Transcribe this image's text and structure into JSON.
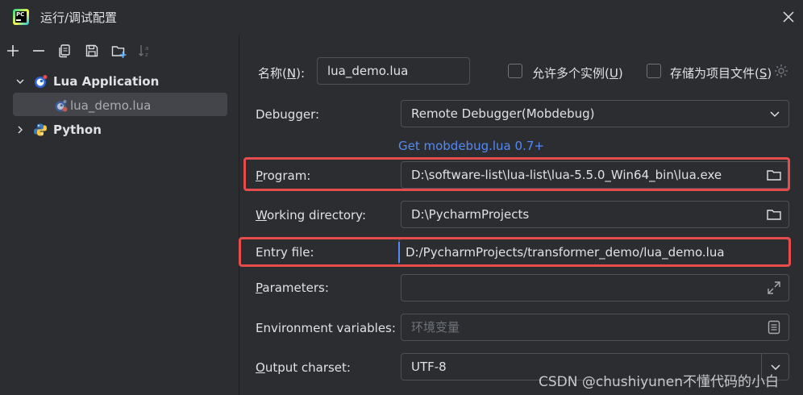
{
  "window": {
    "title": "运行/调试配置",
    "close_icon": "close-icon"
  },
  "toolbar": {
    "icons": [
      "add-icon",
      "remove-icon",
      "copy-icon",
      "save-icon",
      "new-folder-icon",
      "sort-icon"
    ]
  },
  "tree": {
    "items": [
      {
        "label": "Lua Application",
        "icon": "lua-icon",
        "expanded": true
      },
      {
        "label": "lua_demo.lua",
        "icon": "lua-file-icon",
        "selected": true
      },
      {
        "label": "Python",
        "icon": "python-icon",
        "expanded": false
      }
    ]
  },
  "form": {
    "name_label_prefix": "名称(",
    "name_label_mnemonic": "N",
    "name_label_suffix": "):",
    "name_value": "lua_demo.lua",
    "allow_multiple_prefix": "允许多个实例(",
    "allow_multiple_mnemonic": "U",
    "allow_multiple_suffix": ")",
    "store_as_file_prefix": "存储为项目文件(",
    "store_as_file_mnemonic": "S",
    "store_as_file_suffix": ")",
    "debugger_label": "Debugger:",
    "debugger_value": "Remote Debugger(Mobdebug)",
    "debugger_link": "Get mobdebug.lua 0.7+",
    "program_label_mnemonic": "P",
    "program_label_rest": "rogram:",
    "program_value": "D:\\software-list\\lua-list\\lua-5.5.0_Win64_bin\\lua.exe",
    "working_dir_label_mnemonic": "W",
    "working_dir_label_rest": "orking directory:",
    "working_dir_value": "D:\\PycharmProjects",
    "entry_file_label": "Entry file:",
    "entry_file_value": "D:/PycharmProjects/transformer_demo/lua_demo.lua",
    "parameters_label_mnemonic": "P",
    "parameters_label_rest": "arameters:",
    "parameters_value": "",
    "env_label": "Environment variables:",
    "env_placeholder": "环境变量",
    "output_charset_label_mnemonic": "O",
    "output_charset_label_rest": "utput charset:",
    "output_charset_value": "UTF-8"
  },
  "colors": {
    "highlight": "#e74c4c",
    "link": "#548af7",
    "background": "#2b2d30"
  },
  "watermark": "CSDN @chushiyunen不懂代码的小白"
}
